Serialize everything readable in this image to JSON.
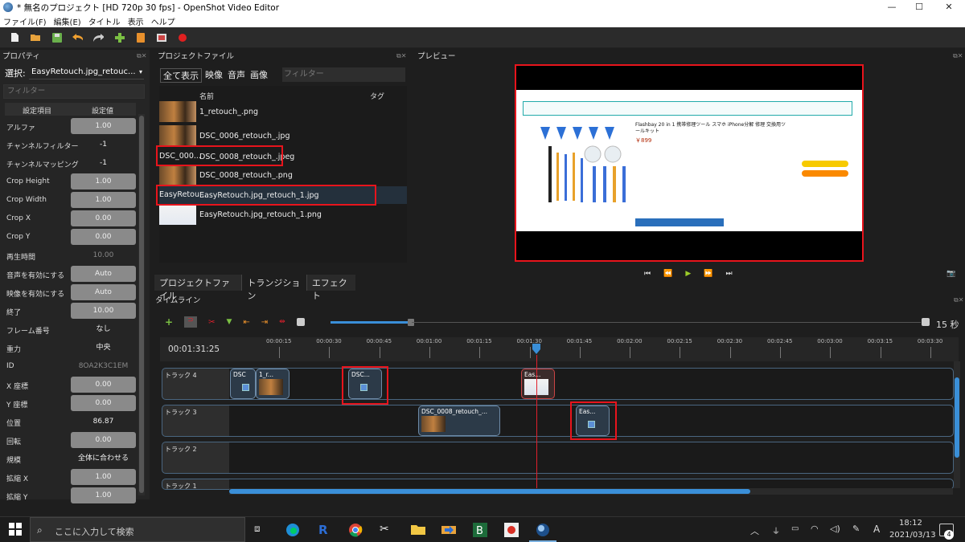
{
  "window": {
    "title": "* 無名のプロジェクト [HD 720p 30 fps] - OpenShot Video Editor",
    "min": "—",
    "max": "☐",
    "close": "✕"
  },
  "menu": [
    "ファイル(F)",
    "編集(E)",
    "タイトル",
    "表示",
    "ヘルプ"
  ],
  "toolbar_icons": [
    "new-project-icon",
    "open-project-icon",
    "save-project-icon",
    "undo-icon",
    "redo-icon",
    "add-file-icon",
    "profile-icon",
    "fullscreen-icon",
    "record-icon"
  ],
  "properties": {
    "header": "プロパティ",
    "selected_label": "選択:",
    "selected_value": "EasyRetouch.jpg_retouc...",
    "filter_placeholder": "フィルター",
    "col_item": "設定項目",
    "col_value": "設定値",
    "rows": [
      {
        "label": "アルファ",
        "value": "1.00",
        "style": "grey"
      },
      {
        "label": "チャンネルフィルター",
        "value": "-1",
        "style": "dark"
      },
      {
        "label": "チャンネルマッピング",
        "value": "-1",
        "style": "dark"
      },
      {
        "label": "Crop Height",
        "value": "1.00",
        "style": "grey"
      },
      {
        "label": "Crop Width",
        "value": "1.00",
        "style": "grey"
      },
      {
        "label": "Crop X",
        "value": "0.00",
        "style": "grey"
      },
      {
        "label": "Crop Y",
        "value": "0.00",
        "style": "grey"
      },
      {
        "label": "再生時間",
        "value": "10.00",
        "style": "muted"
      },
      {
        "label": "音声を有効にする",
        "value": "Auto",
        "style": "grey"
      },
      {
        "label": "映像を有効にする",
        "value": "Auto",
        "style": "grey"
      },
      {
        "label": "終了",
        "value": "10.00",
        "style": "grey"
      },
      {
        "label": "フレーム番号",
        "value": "なし",
        "style": "dark"
      },
      {
        "label": "重力",
        "value": "中央",
        "style": "dark"
      },
      {
        "label": "ID",
        "value": "8OA2K3C1EM",
        "style": "muted"
      },
      {
        "label": "X 座標",
        "value": "0.00",
        "style": "grey"
      },
      {
        "label": "Y 座標",
        "value": "0.00",
        "style": "grey"
      },
      {
        "label": "位置",
        "value": "86.87",
        "style": "dark"
      },
      {
        "label": "回転",
        "value": "0.00",
        "style": "grey"
      },
      {
        "label": "規模",
        "value": "全体に合わせる",
        "style": "dark"
      },
      {
        "label": "拡縮 X",
        "value": "1.00",
        "style": "grey"
      },
      {
        "label": "拡縮 Y",
        "value": "1.00",
        "style": "grey"
      }
    ]
  },
  "project_files": {
    "header": "プロジェクトファイル",
    "filters": [
      "全て表示",
      "映像",
      "音声",
      "画像"
    ],
    "filter_placeholder": "フィルター",
    "col_name": "名前",
    "col_tag": "タグ",
    "files": [
      {
        "name": "1_retouch_.png",
        "thumb": "photo",
        "thumb_text": ""
      },
      {
        "name": "DSC_0006_retouch_.jpg",
        "thumb": "photo",
        "thumb_text": ""
      },
      {
        "name": "DSC_0008_retouch_.jpeg",
        "thumb": "text",
        "thumb_text": "DSC_000..."
      },
      {
        "name": "DSC_0008_retouch_.png",
        "thumb": "photo",
        "thumb_text": ""
      },
      {
        "name": "EasyRetouch.jpg_retouch_1.jpg",
        "thumb": "text",
        "thumb_text": "EasyRetou..."
      },
      {
        "name": "EasyRetouch.jpg_retouch_1.png",
        "thumb": "white",
        "thumb_text": ""
      }
    ],
    "bottom_tabs": [
      "プロジェクトファイル",
      "トランジション",
      "エフェクト"
    ]
  },
  "preview": {
    "header": "プレビュー",
    "page_title": "Flashbay 20 in 1 携帯修理ツール スマホ iPhone分解 修理 交換用ツールキット",
    "price": "￥899",
    "controls": [
      "skip-start-icon",
      "rewind-icon",
      "play-icon",
      "fast-forward-icon",
      "skip-end-icon"
    ]
  },
  "timeline": {
    "header": "タイムライン",
    "timecode": "00:01:31:25",
    "zoom_label": "15 秒",
    "ruler": [
      "00:00:15",
      "00:00:30",
      "00:00:45",
      "00:01:00",
      "00:01:15",
      "00:01:30",
      "00:01:45",
      "00:02:00",
      "00:02:15",
      "00:02:30",
      "00:02:45",
      "00:03:00",
      "00:03:15",
      "00:03:30"
    ],
    "tracks": [
      {
        "name": "トラック 4",
        "clips": [
          "DSC",
          "1_r...",
          "DSC...",
          "Eas..."
        ]
      },
      {
        "name": "トラック 3",
        "clips": [
          "DSC_0008_retouch_...",
          "Eas..."
        ]
      },
      {
        "name": "トラック 2",
        "clips": []
      },
      {
        "name": "トラック 1",
        "clips": []
      }
    ]
  },
  "taskbar": {
    "search_placeholder": "ここに入力して検索",
    "time": "18:12",
    "date": "2021/03/13",
    "ime": "A",
    "notifications": "4"
  }
}
